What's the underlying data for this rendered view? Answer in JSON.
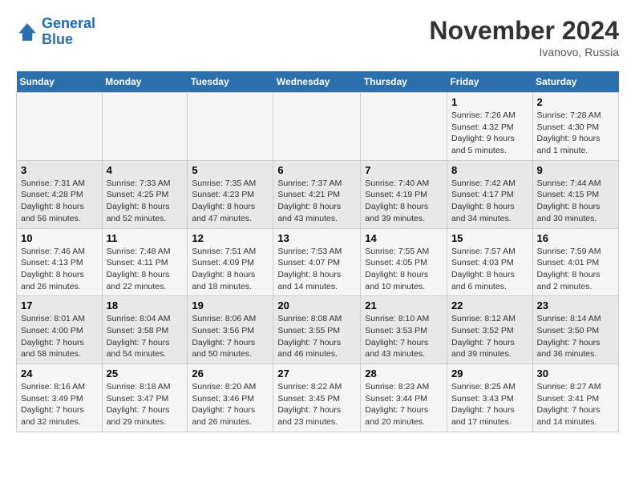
{
  "logo": {
    "line1": "General",
    "line2": "Blue"
  },
  "title": "November 2024",
  "subtitle": "Ivanovo, Russia",
  "days_header": [
    "Sunday",
    "Monday",
    "Tuesday",
    "Wednesday",
    "Thursday",
    "Friday",
    "Saturday"
  ],
  "weeks": [
    [
      {
        "day": "",
        "info": ""
      },
      {
        "day": "",
        "info": ""
      },
      {
        "day": "",
        "info": ""
      },
      {
        "day": "",
        "info": ""
      },
      {
        "day": "",
        "info": ""
      },
      {
        "day": "1",
        "info": "Sunrise: 7:26 AM\nSunset: 4:32 PM\nDaylight: 9 hours\nand 5 minutes."
      },
      {
        "day": "2",
        "info": "Sunrise: 7:28 AM\nSunset: 4:30 PM\nDaylight: 9 hours\nand 1 minute."
      }
    ],
    [
      {
        "day": "3",
        "info": "Sunrise: 7:31 AM\nSunset: 4:28 PM\nDaylight: 8 hours\nand 56 minutes."
      },
      {
        "day": "4",
        "info": "Sunrise: 7:33 AM\nSunset: 4:25 PM\nDaylight: 8 hours\nand 52 minutes."
      },
      {
        "day": "5",
        "info": "Sunrise: 7:35 AM\nSunset: 4:23 PM\nDaylight: 8 hours\nand 47 minutes."
      },
      {
        "day": "6",
        "info": "Sunrise: 7:37 AM\nSunset: 4:21 PM\nDaylight: 8 hours\nand 43 minutes."
      },
      {
        "day": "7",
        "info": "Sunrise: 7:40 AM\nSunset: 4:19 PM\nDaylight: 8 hours\nand 39 minutes."
      },
      {
        "day": "8",
        "info": "Sunrise: 7:42 AM\nSunset: 4:17 PM\nDaylight: 8 hours\nand 34 minutes."
      },
      {
        "day": "9",
        "info": "Sunrise: 7:44 AM\nSunset: 4:15 PM\nDaylight: 8 hours\nand 30 minutes."
      }
    ],
    [
      {
        "day": "10",
        "info": "Sunrise: 7:46 AM\nSunset: 4:13 PM\nDaylight: 8 hours\nand 26 minutes."
      },
      {
        "day": "11",
        "info": "Sunrise: 7:48 AM\nSunset: 4:11 PM\nDaylight: 8 hours\nand 22 minutes."
      },
      {
        "day": "12",
        "info": "Sunrise: 7:51 AM\nSunset: 4:09 PM\nDaylight: 8 hours\nand 18 minutes."
      },
      {
        "day": "13",
        "info": "Sunrise: 7:53 AM\nSunset: 4:07 PM\nDaylight: 8 hours\nand 14 minutes."
      },
      {
        "day": "14",
        "info": "Sunrise: 7:55 AM\nSunset: 4:05 PM\nDaylight: 8 hours\nand 10 minutes."
      },
      {
        "day": "15",
        "info": "Sunrise: 7:57 AM\nSunset: 4:03 PM\nDaylight: 8 hours\nand 6 minutes."
      },
      {
        "day": "16",
        "info": "Sunrise: 7:59 AM\nSunset: 4:01 PM\nDaylight: 8 hours\nand 2 minutes."
      }
    ],
    [
      {
        "day": "17",
        "info": "Sunrise: 8:01 AM\nSunset: 4:00 PM\nDaylight: 7 hours\nand 58 minutes."
      },
      {
        "day": "18",
        "info": "Sunrise: 8:04 AM\nSunset: 3:58 PM\nDaylight: 7 hours\nand 54 minutes."
      },
      {
        "day": "19",
        "info": "Sunrise: 8:06 AM\nSunset: 3:56 PM\nDaylight: 7 hours\nand 50 minutes."
      },
      {
        "day": "20",
        "info": "Sunrise: 8:08 AM\nSunset: 3:55 PM\nDaylight: 7 hours\nand 46 minutes."
      },
      {
        "day": "21",
        "info": "Sunrise: 8:10 AM\nSunset: 3:53 PM\nDaylight: 7 hours\nand 43 minutes."
      },
      {
        "day": "22",
        "info": "Sunrise: 8:12 AM\nSunset: 3:52 PM\nDaylight: 7 hours\nand 39 minutes."
      },
      {
        "day": "23",
        "info": "Sunrise: 8:14 AM\nSunset: 3:50 PM\nDaylight: 7 hours\nand 36 minutes."
      }
    ],
    [
      {
        "day": "24",
        "info": "Sunrise: 8:16 AM\nSunset: 3:49 PM\nDaylight: 7 hours\nand 32 minutes."
      },
      {
        "day": "25",
        "info": "Sunrise: 8:18 AM\nSunset: 3:47 PM\nDaylight: 7 hours\nand 29 minutes."
      },
      {
        "day": "26",
        "info": "Sunrise: 8:20 AM\nSunset: 3:46 PM\nDaylight: 7 hours\nand 26 minutes."
      },
      {
        "day": "27",
        "info": "Sunrise: 8:22 AM\nSunset: 3:45 PM\nDaylight: 7 hours\nand 23 minutes."
      },
      {
        "day": "28",
        "info": "Sunrise: 8:23 AM\nSunset: 3:44 PM\nDaylight: 7 hours\nand 20 minutes."
      },
      {
        "day": "29",
        "info": "Sunrise: 8:25 AM\nSunset: 3:43 PM\nDaylight: 7 hours\nand 17 minutes."
      },
      {
        "day": "30",
        "info": "Sunrise: 8:27 AM\nSunset: 3:41 PM\nDaylight: 7 hours\nand 14 minutes."
      }
    ]
  ]
}
